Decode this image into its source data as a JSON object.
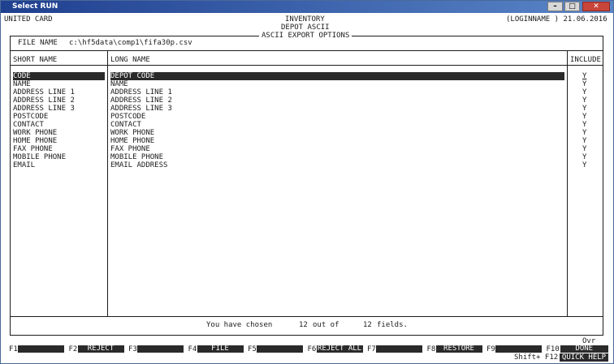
{
  "window": {
    "title": "Select RUN",
    "controls": [
      "minimize-icon",
      "maximize-icon",
      "close-icon"
    ]
  },
  "header": {
    "company": "UNITED CARD",
    "module": "INVENTORY",
    "user": "(LOGINNAME ) 21.06.2016",
    "screen": "DEPOT ASCII",
    "panel_title": "ASCII EXPORT OPTIONS"
  },
  "file": {
    "label": "FILE NAME",
    "value": "c:\\hf5data\\comp1\\fifa30p.csv"
  },
  "columns": {
    "short": "SHORT NAME",
    "long": "LONG NAME",
    "include": "INCLUDE"
  },
  "rows": [
    {
      "short": "CODE",
      "long": "DEPOT CODE",
      "include": "Y"
    },
    {
      "short": "NAME",
      "long": "NAME",
      "include": "Y"
    },
    {
      "short": "ADDRESS LINE 1",
      "long": "ADDRESS LINE 1",
      "include": "Y"
    },
    {
      "short": "ADDRESS LINE 2",
      "long": "ADDRESS LINE 2",
      "include": "Y"
    },
    {
      "short": "ADDRESS LINE 3",
      "long": "ADDRESS LINE 3",
      "include": "Y"
    },
    {
      "short": "POSTCODE",
      "long": "POSTCODE",
      "include": "Y"
    },
    {
      "short": "CONTACT",
      "long": "CONTACT",
      "include": "Y"
    },
    {
      "short": "WORK PHONE",
      "long": "WORK PHONE",
      "include": "Y"
    },
    {
      "short": "HOME PHONE",
      "long": "HOME PHONE",
      "include": "Y"
    },
    {
      "short": "FAX PHONE",
      "long": "FAX PHONE",
      "include": "Y"
    },
    {
      "short": "MOBILE PHONE",
      "long": "MOBILE PHONE",
      "include": "Y"
    },
    {
      "short": "EMAIL",
      "long": "EMAIL ADDRESS",
      "include": "Y"
    }
  ],
  "status": {
    "prefix": "You have chosen",
    "chosen": "12",
    "middle": "out of",
    "total": "12",
    "suffix": "fields."
  },
  "mode": "Ovr",
  "fkeys": [
    {
      "key": "F1",
      "label": ""
    },
    {
      "key": "F2",
      "label": "REJECT"
    },
    {
      "key": "F3",
      "label": ""
    },
    {
      "key": "F4",
      "label": "FILE"
    },
    {
      "key": "F5",
      "label": ""
    },
    {
      "key": "F6",
      "label": "REJECT ALL"
    },
    {
      "key": "F7",
      "label": ""
    },
    {
      "key": "F8",
      "label": "RESTORE"
    },
    {
      "key": "F9",
      "label": ""
    },
    {
      "key": "F10",
      "label": "DONE"
    }
  ],
  "shift_key": {
    "key": "Shift+ F12",
    "label": "QUICK HELP"
  }
}
